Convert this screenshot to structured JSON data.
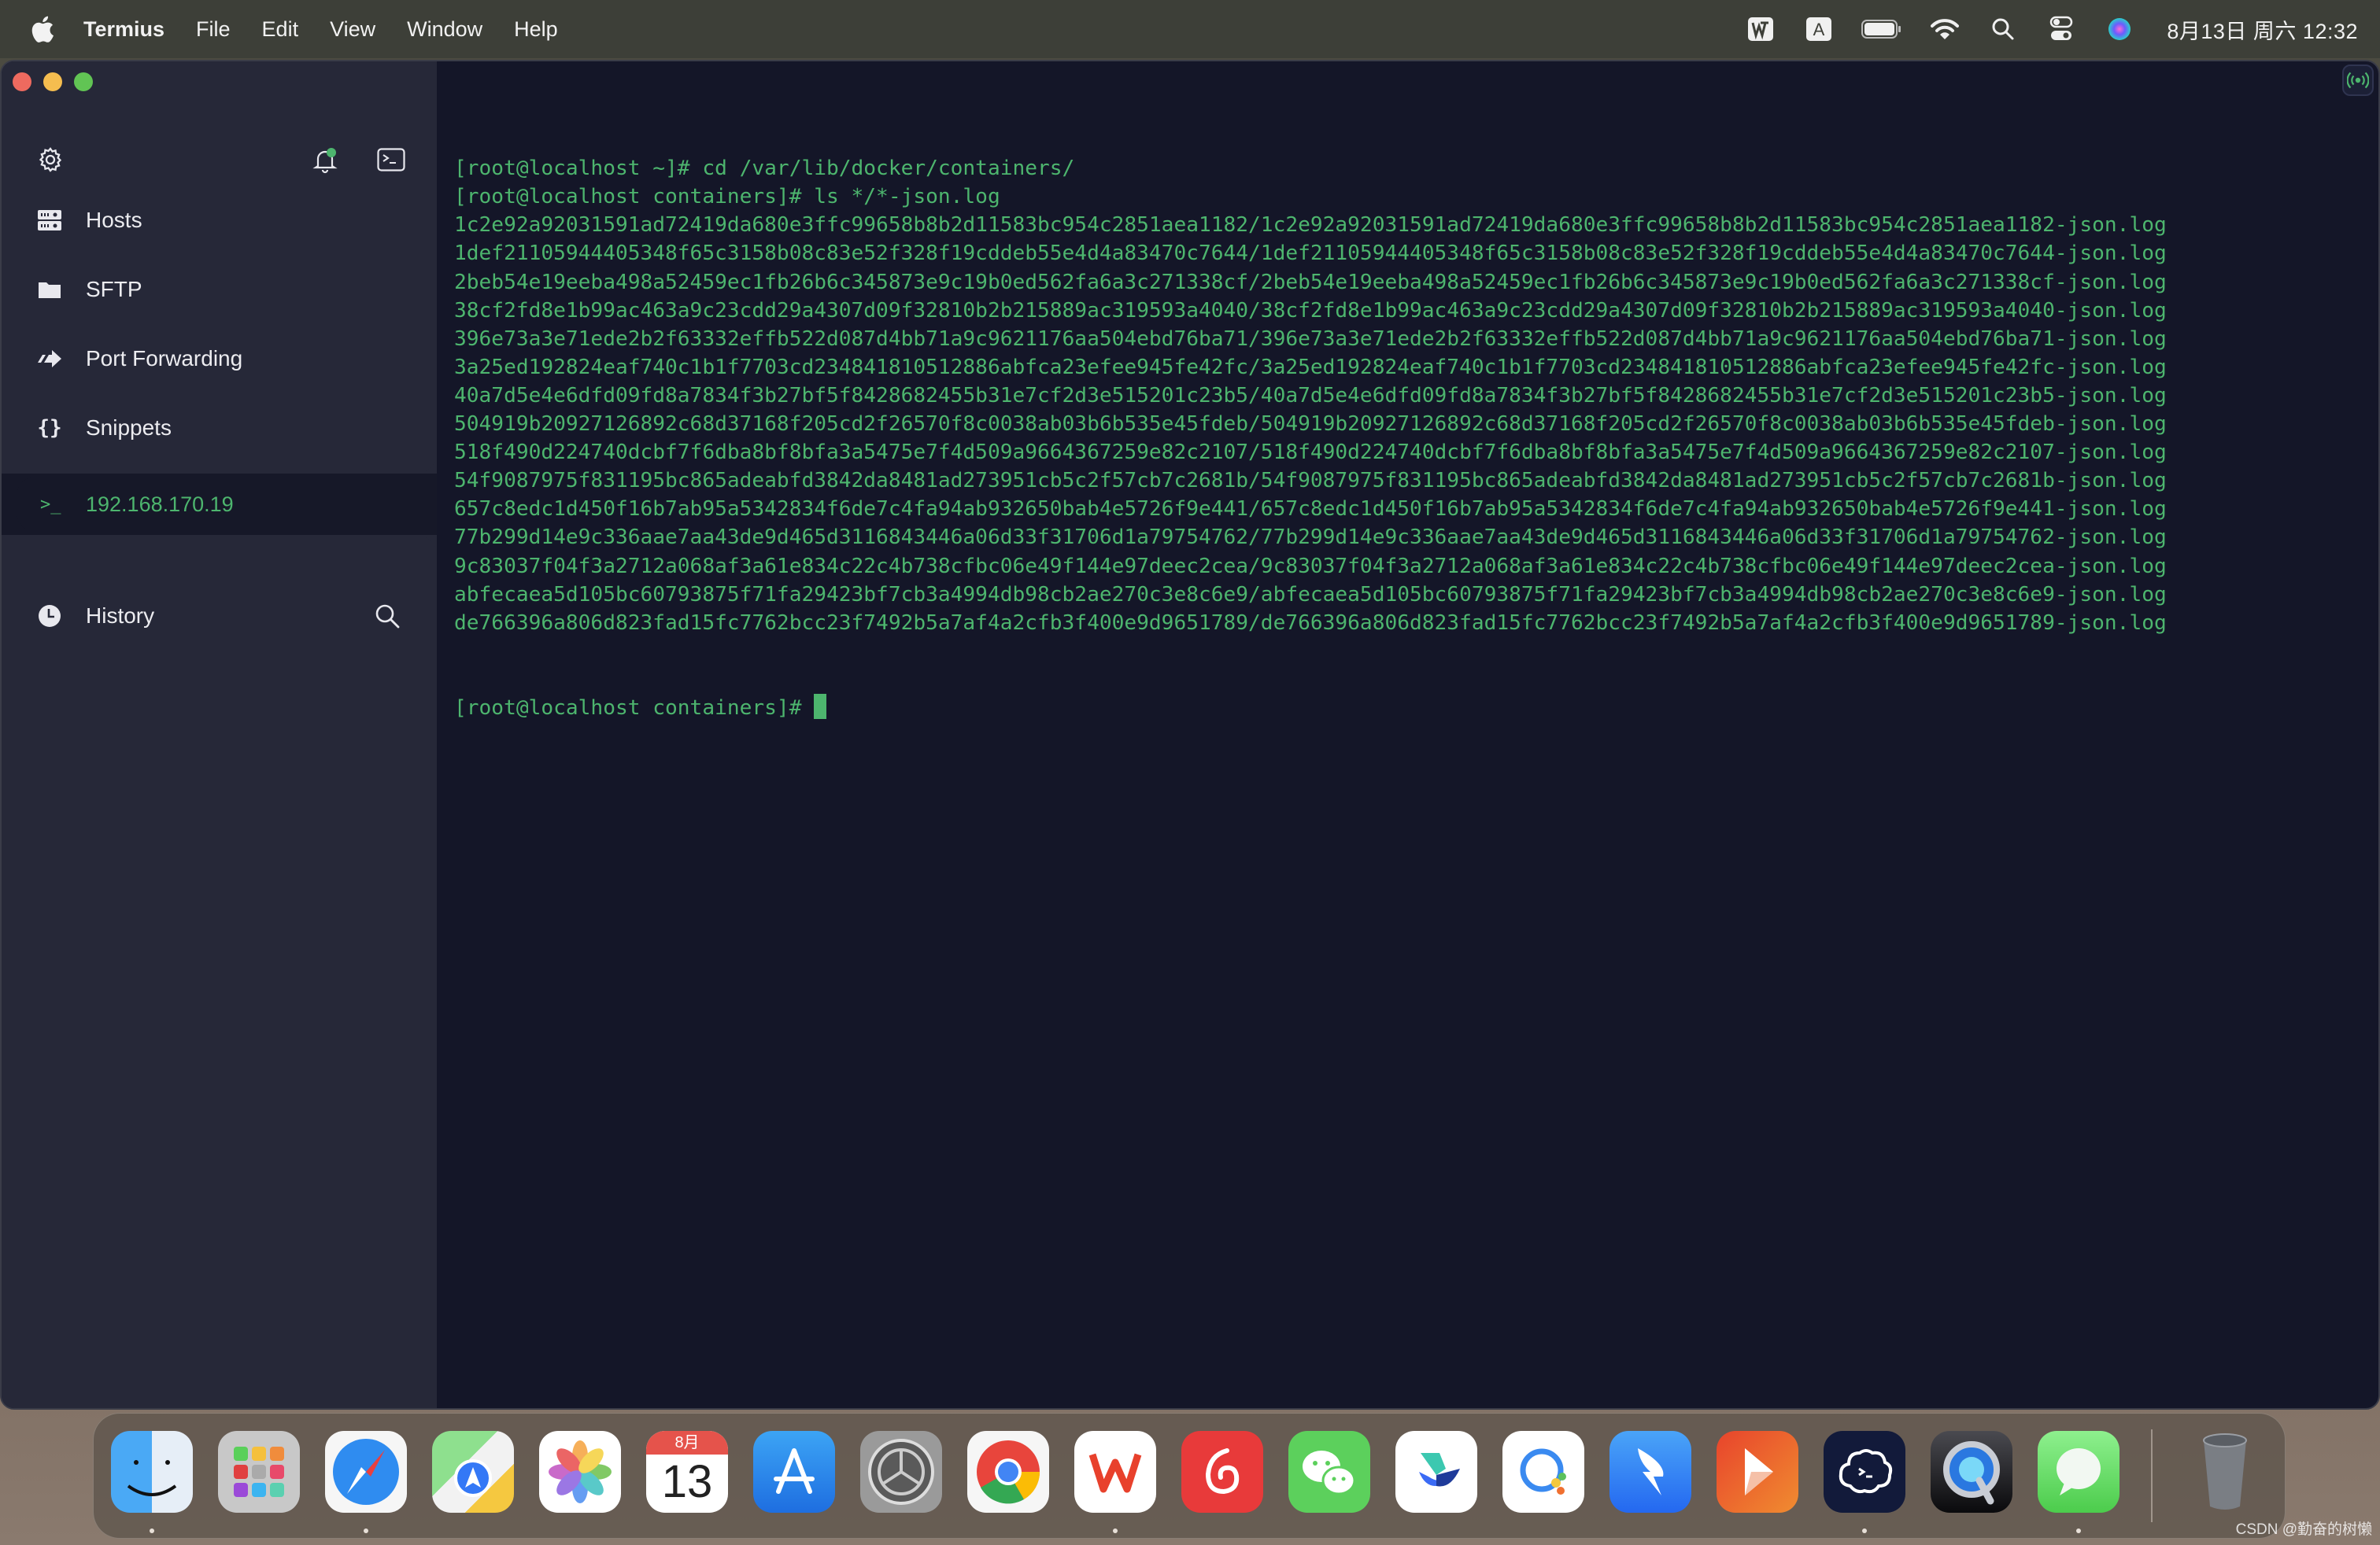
{
  "menubar": {
    "app_name": "Termius",
    "menus": [
      "File",
      "Edit",
      "View",
      "Window",
      "Help"
    ],
    "tray": [
      "wps-icon",
      "input-method-icon",
      "battery-icon",
      "wifi-icon",
      "spotlight-icon",
      "control-center-icon",
      "siri-icon"
    ],
    "input_method_label": "A",
    "clock": "8月13日 周六  12:32"
  },
  "sidebar": {
    "items": [
      {
        "label": "Hosts",
        "icon": "hosts-icon"
      },
      {
        "label": "SFTP",
        "icon": "folder-icon"
      },
      {
        "label": "Port Forwarding",
        "icon": "port-forwarding-icon"
      },
      {
        "label": "Snippets",
        "icon": "snippets-icon"
      }
    ],
    "active_session": {
      "label": "192.168.170.19",
      "icon": "terminal-prompt-icon",
      "icon_glyph": ">_"
    },
    "history": {
      "label": "History"
    }
  },
  "terminal": {
    "lines": [
      "[root@localhost ~]# cd /var/lib/docker/containers/",
      "[root@localhost containers]# ls */*-json.log",
      "1c2e92a92031591ad72419da680e3ffc99658b8b2d11583bc954c2851aea1182/1c2e92a92031591ad72419da680e3ffc99658b8b2d11583bc954c2851aea1182-json.log",
      "1def21105944405348f65c3158b08c83e52f328f19cddeb55e4d4a83470c7644/1def21105944405348f65c3158b08c83e52f328f19cddeb55e4d4a83470c7644-json.log",
      "2beb54e19eeba498a52459ec1fb26b6c345873e9c19b0ed562fa6a3c271338cf/2beb54e19eeba498a52459ec1fb26b6c345873e9c19b0ed562fa6a3c271338cf-json.log",
      "38cf2fd8e1b99ac463a9c23cdd29a4307d09f32810b2b215889ac319593a4040/38cf2fd8e1b99ac463a9c23cdd29a4307d09f32810b2b215889ac319593a4040-json.log",
      "396e73a3e71ede2b2f63332effb522d087d4bb71a9c9621176aa504ebd76ba71/396e73a3e71ede2b2f63332effb522d087d4bb71a9c9621176aa504ebd76ba71-json.log",
      "3a25ed192824eaf740c1b1f7703cd234841810512886abfca23efee945fe42fc/3a25ed192824eaf740c1b1f7703cd234841810512886abfca23efee945fe42fc-json.log",
      "40a7d5e4e6dfd09fd8a7834f3b27bf5f8428682455b31e7cf2d3e515201c23b5/40a7d5e4e6dfd09fd8a7834f3b27bf5f8428682455b31e7cf2d3e515201c23b5-json.log",
      "504919b20927126892c68d37168f205cd2f26570f8c0038ab03b6b535e45fdeb/504919b20927126892c68d37168f205cd2f26570f8c0038ab03b6b535e45fdeb-json.log",
      "518f490d224740dcbf7f6dba8bf8bfa3a5475e7f4d509a9664367259e82c2107/518f490d224740dcbf7f6dba8bf8bfa3a5475e7f4d509a9664367259e82c2107-json.log",
      "54f9087975f831195bc865adeabfd3842da8481ad273951cb5c2f57cb7c2681b/54f9087975f831195bc865adeabfd3842da8481ad273951cb5c2f57cb7c2681b-json.log",
      "657c8edc1d450f16b7ab95a5342834f6de7c4fa94ab932650bab4e5726f9e441/657c8edc1d450f16b7ab95a5342834f6de7c4fa94ab932650bab4e5726f9e441-json.log",
      "77b299d14e9c336aae7aa43de9d465d3116843446a06d33f31706d1a79754762/77b299d14e9c336aae7aa43de9d465d3116843446a06d33f31706d1a79754762-json.log",
      "9c83037f04f3a2712a068af3a61e834c22c4b738cfbc06e49f144e97deec2cea/9c83037f04f3a2712a068af3a61e834c22c4b738cfbc06e49f144e97deec2cea-json.log",
      "abfecaea5d105bc60793875f71fa29423bf7cb3a4994db98cb2ae270c3e8c6e9/abfecaea5d105bc60793875f71fa29423bf7cb3a4994db98cb2ae270c3e8c6e9-json.log",
      "de766396a806d823fad15fc7762bcc23f7492b5a7af4a2cfb3f400e9d9651789/de766396a806d823fad15fc7762bcc23f7492b5a7af4a2cfb3f400e9d9651789-json.log"
    ],
    "prompt": "[root@localhost containers]# "
  },
  "dock": {
    "apps": [
      {
        "name": "finder",
        "running": true
      },
      {
        "name": "launchpad",
        "running": false
      },
      {
        "name": "safari",
        "running": true
      },
      {
        "name": "maps",
        "running": false
      },
      {
        "name": "photos",
        "running": false
      },
      {
        "name": "calendar",
        "running": false,
        "month": "8月",
        "day": "13"
      },
      {
        "name": "app-store",
        "running": false
      },
      {
        "name": "system-preferences",
        "running": false
      },
      {
        "name": "chrome",
        "running": false
      },
      {
        "name": "wps",
        "running": true
      },
      {
        "name": "netease-music",
        "running": false
      },
      {
        "name": "wechat",
        "running": false
      },
      {
        "name": "feishu",
        "running": false
      },
      {
        "name": "tencent-meeting",
        "running": false
      },
      {
        "name": "dingtalk",
        "running": false
      },
      {
        "name": "infuse",
        "running": false
      },
      {
        "name": "termius",
        "running": true
      },
      {
        "name": "quicktime",
        "running": false
      },
      {
        "name": "messages",
        "running": true
      },
      {
        "name": "trash",
        "running": false
      }
    ]
  },
  "watermark": "CSDN @勤奋的树懒",
  "colors": {
    "terminal_text": "#4db56e",
    "terminal_bg": "#141628",
    "sidebar_bg": "#262838",
    "accent": "#4db56e"
  }
}
